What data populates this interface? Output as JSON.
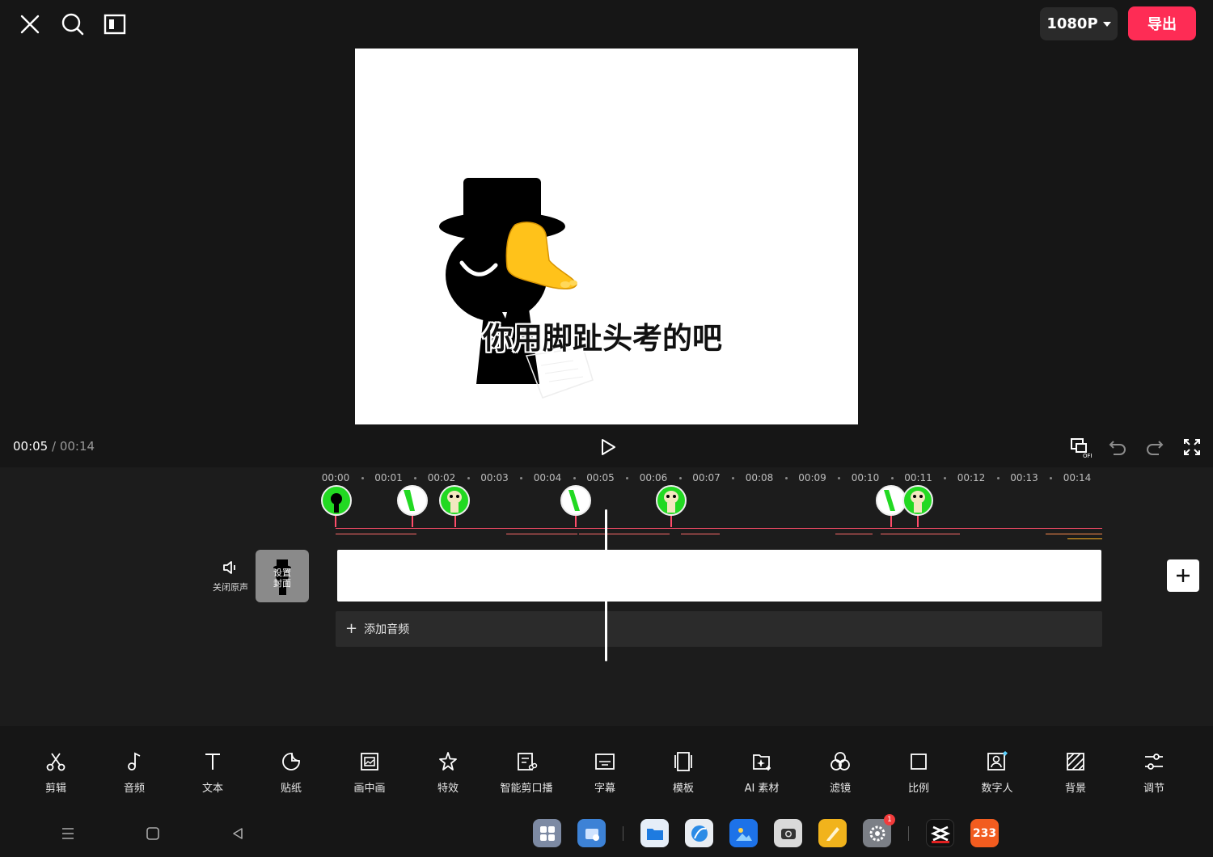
{
  "topbar": {
    "close_icon": "close-icon",
    "search_icon": "search-icon",
    "layout_icon": "layout-icon",
    "resolution": "1080P",
    "export_label": "导出",
    "export_color": "#fe2c55"
  },
  "preview": {
    "caption": "你用脚趾头考的吧"
  },
  "playback": {
    "current_time": "00:05",
    "separator": " / ",
    "total_time": "00:14"
  },
  "timeline": {
    "ruler_labels": [
      "00:00",
      "00:01",
      "00:02",
      "00:03",
      "00:04",
      "00:05",
      "00:06",
      "00:07",
      "00:08",
      "00:09",
      "00:10",
      "00:11",
      "00:12",
      "00:13",
      "00:14"
    ],
    "mute_label": "关闭原声",
    "cover_label": "设置\n封面",
    "add_audio_label": "添加音频",
    "playhead_time": "00:05"
  },
  "toolbar": {
    "items": [
      {
        "label": "剪辑",
        "icon": "scissors-icon"
      },
      {
        "label": "音频",
        "icon": "music-note-icon"
      },
      {
        "label": "文本",
        "icon": "text-icon"
      },
      {
        "label": "贴纸",
        "icon": "sticker-icon"
      },
      {
        "label": "画中画",
        "icon": "picture-in-picture-icon"
      },
      {
        "label": "特效",
        "icon": "effects-star-icon"
      },
      {
        "label": "智能剪口播",
        "icon": "smart-cut-icon"
      },
      {
        "label": "字幕",
        "icon": "subtitle-icon"
      },
      {
        "label": "模板",
        "icon": "template-icon"
      },
      {
        "label": "AI 素材",
        "icon": "ai-material-icon"
      },
      {
        "label": "滤镜",
        "icon": "filter-icon"
      },
      {
        "label": "比例",
        "icon": "ratio-icon"
      },
      {
        "label": "数字人",
        "icon": "digital-human-icon"
      },
      {
        "label": "背景",
        "icon": "background-icon"
      },
      {
        "label": "调节",
        "icon": "adjust-icon"
      }
    ]
  },
  "dock": {
    "settings_badge": "1",
    "app_233_label": "233"
  }
}
